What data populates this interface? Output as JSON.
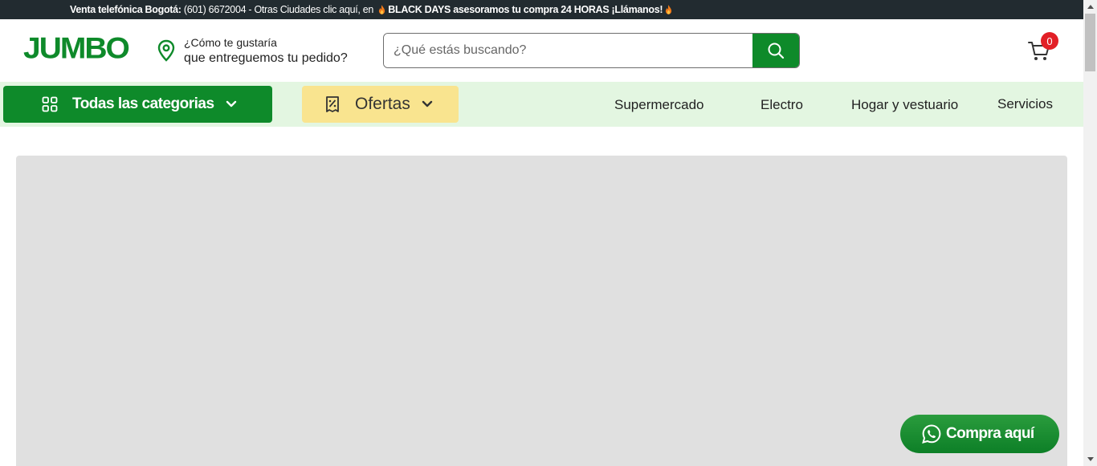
{
  "topbar": {
    "label_bold": "Venta telefónica Bogotá:",
    "phone": " (601) 6672004 - Otras Ciudades clic aquí,",
    "en": " en ",
    "promo": "BLACK DAYS asesoramos tu compra 24 HORAS ¡Llámanos!"
  },
  "header": {
    "logo": "JUMBO",
    "location_line1": "¿Cómo te gustaría",
    "location_line2": "que entreguemos tu pedido?",
    "search_placeholder": "¿Qué estás buscando?",
    "cart_count": "0"
  },
  "nav": {
    "categories_label": "Todas las categorias",
    "offers_label": "Ofertas",
    "links": [
      "Supermercado",
      "Electro",
      "Hogar y vestuario",
      "Servicios"
    ]
  },
  "whatsapp_button": "Compra aquí",
  "colors": {
    "brand_green": "#0e8a2a",
    "nav_bg": "#e3f6e1",
    "offers_yellow": "#f9e48f",
    "topbar_bg": "#222b30",
    "badge_red": "#e21f26"
  },
  "icons": [
    "location-pin-icon",
    "search-icon",
    "cart-icon",
    "grid-icon",
    "chevron-down-icon",
    "tag-icon",
    "whatsapp-icon",
    "flame-icon"
  ]
}
